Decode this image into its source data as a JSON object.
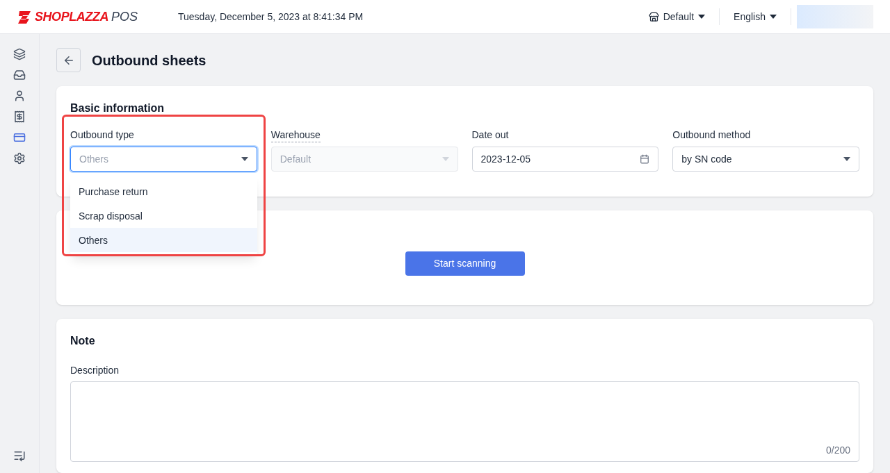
{
  "header": {
    "logo_brand": "SHOPLAZZA",
    "logo_suffix": "POS",
    "datetime": "Tuesday, December 5, 2023 at 8:41:34 PM",
    "store": "Default",
    "language": "English"
  },
  "sidebar": {
    "items": [
      {
        "selected": false
      },
      {
        "selected": false
      },
      {
        "selected": false
      },
      {
        "selected": false
      },
      {
        "selected": true
      },
      {
        "selected": false
      }
    ]
  },
  "page_title": "Outbound sheets",
  "basic_information": {
    "title": "Basic information",
    "fields": [
      {
        "label": "Outbound type",
        "kind": "select",
        "value": "Others",
        "disabled": false,
        "open": true,
        "options": [
          {
            "label": "Purchase return",
            "selected": false
          },
          {
            "label": "Scrap disposal",
            "selected": false
          },
          {
            "label": "Others",
            "selected": true
          }
        ]
      },
      {
        "label": "Warehouse",
        "kind": "select",
        "value": "Default",
        "disabled": true,
        "open": false
      },
      {
        "label": "Date out",
        "kind": "date",
        "value": "2023-12-05",
        "disabled": false,
        "open": false
      },
      {
        "label": "Outbound method",
        "kind": "select",
        "value": "by SN code",
        "disabled": false,
        "open": false
      }
    ]
  },
  "scan": {
    "button": "Start scanning"
  },
  "note": {
    "title": "Note",
    "label": "Description",
    "counter": "0/200"
  }
}
